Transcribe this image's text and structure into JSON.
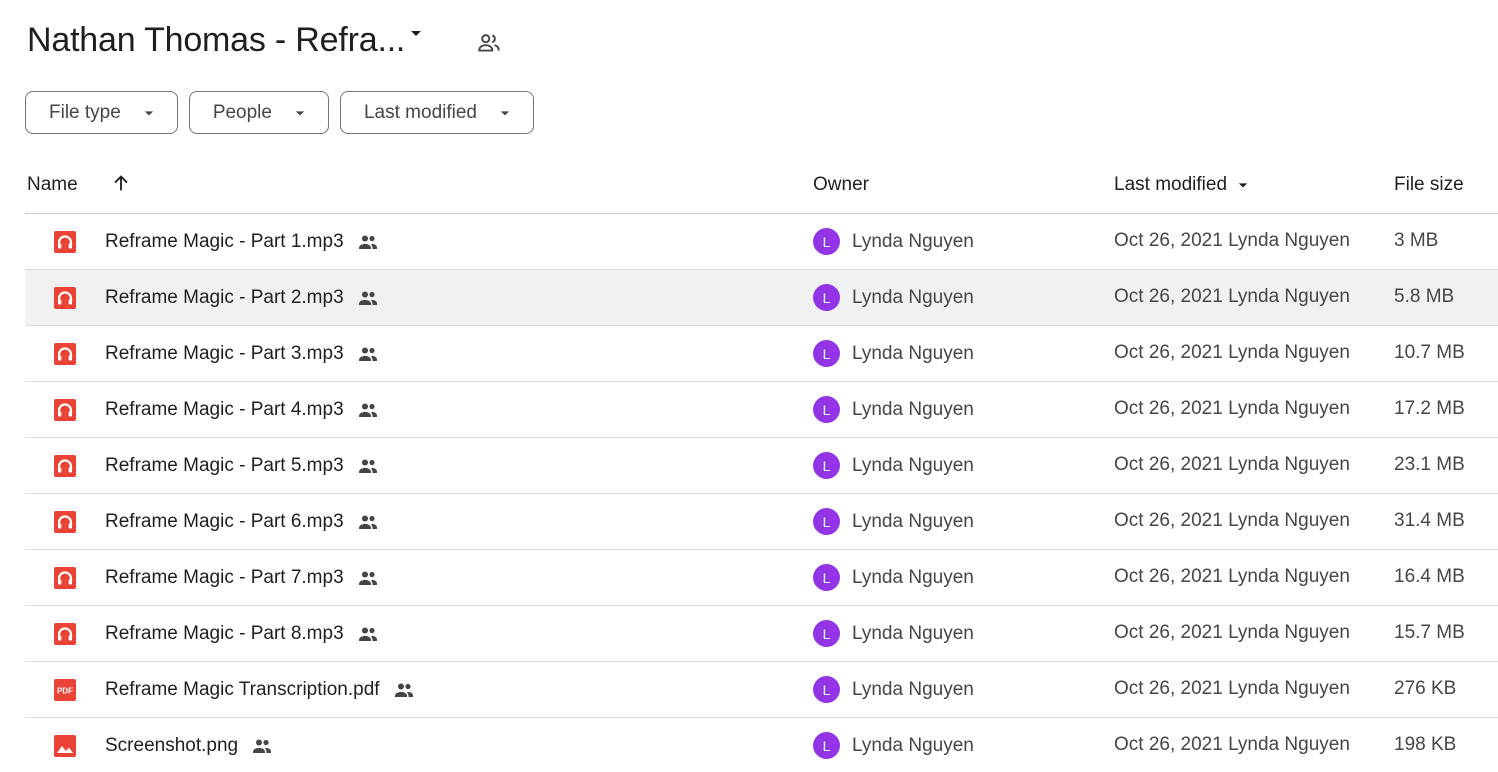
{
  "header": {
    "title": "Nathan Thomas - Refra..."
  },
  "filters": [
    {
      "label": "File type"
    },
    {
      "label": "People"
    },
    {
      "label": "Last modified"
    }
  ],
  "table": {
    "columns": {
      "name": "Name",
      "owner": "Owner",
      "last_modified": "Last modified",
      "file_size": "File size"
    },
    "rows": [
      {
        "name": "Reframe Magic - Part 1.mp3",
        "type": "audio",
        "owner_initial": "L",
        "owner": "Lynda Nguyen",
        "modified": "Oct 26, 2021 Lynda Nguyen",
        "size": "3 MB",
        "selected": false
      },
      {
        "name": "Reframe Magic - Part 2.mp3",
        "type": "audio",
        "owner_initial": "L",
        "owner": "Lynda Nguyen",
        "modified": "Oct 26, 2021 Lynda Nguyen",
        "size": "5.8 MB",
        "selected": true
      },
      {
        "name": "Reframe Magic - Part 3.mp3",
        "type": "audio",
        "owner_initial": "L",
        "owner": "Lynda Nguyen",
        "modified": "Oct 26, 2021 Lynda Nguyen",
        "size": "10.7 MB",
        "selected": false
      },
      {
        "name": "Reframe Magic - Part 4.mp3",
        "type": "audio",
        "owner_initial": "L",
        "owner": "Lynda Nguyen",
        "modified": "Oct 26, 2021 Lynda Nguyen",
        "size": "17.2 MB",
        "selected": false
      },
      {
        "name": "Reframe Magic - Part 5.mp3",
        "type": "audio",
        "owner_initial": "L",
        "owner": "Lynda Nguyen",
        "modified": "Oct 26, 2021 Lynda Nguyen",
        "size": "23.1 MB",
        "selected": false
      },
      {
        "name": "Reframe Magic - Part 6.mp3",
        "type": "audio",
        "owner_initial": "L",
        "owner": "Lynda Nguyen",
        "modified": "Oct 26, 2021 Lynda Nguyen",
        "size": "31.4 MB",
        "selected": false
      },
      {
        "name": "Reframe Magic - Part 7.mp3",
        "type": "audio",
        "owner_initial": "L",
        "owner": "Lynda Nguyen",
        "modified": "Oct 26, 2021 Lynda Nguyen",
        "size": "16.4 MB",
        "selected": false
      },
      {
        "name": "Reframe Magic - Part 8.mp3",
        "type": "audio",
        "owner_initial": "L",
        "owner": "Lynda Nguyen",
        "modified": "Oct 26, 2021 Lynda Nguyen",
        "size": "15.7 MB",
        "selected": false
      },
      {
        "name": "Reframe Magic Transcription.pdf",
        "type": "pdf",
        "owner_initial": "L",
        "owner": "Lynda Nguyen",
        "modified": "Oct 26, 2021 Lynda Nguyen",
        "size": "276 KB",
        "selected": false
      },
      {
        "name": "Screenshot.png",
        "type": "image",
        "owner_initial": "L",
        "owner": "Lynda Nguyen",
        "modified": "Oct 26, 2021 Lynda Nguyen",
        "size": "198 KB",
        "selected": false
      }
    ]
  },
  "icons": {
    "title_dropdown": "arrow-drop-down-icon",
    "title_shared": "shared-folder-icon",
    "sort_name": "arrow-upward-icon",
    "sort_modified": "arrow-drop-down-icon",
    "audio": "audio-file-icon",
    "pdf": "pdf-file-icon",
    "image": "image-file-icon",
    "shared": "people-icon"
  },
  "colors": {
    "file_icon_red": "#ea4335",
    "avatar_purple": "#9334e6",
    "selected_row": "#f0f2f1",
    "text_primary": "#1f1f1f",
    "text_secondary": "#444746"
  }
}
